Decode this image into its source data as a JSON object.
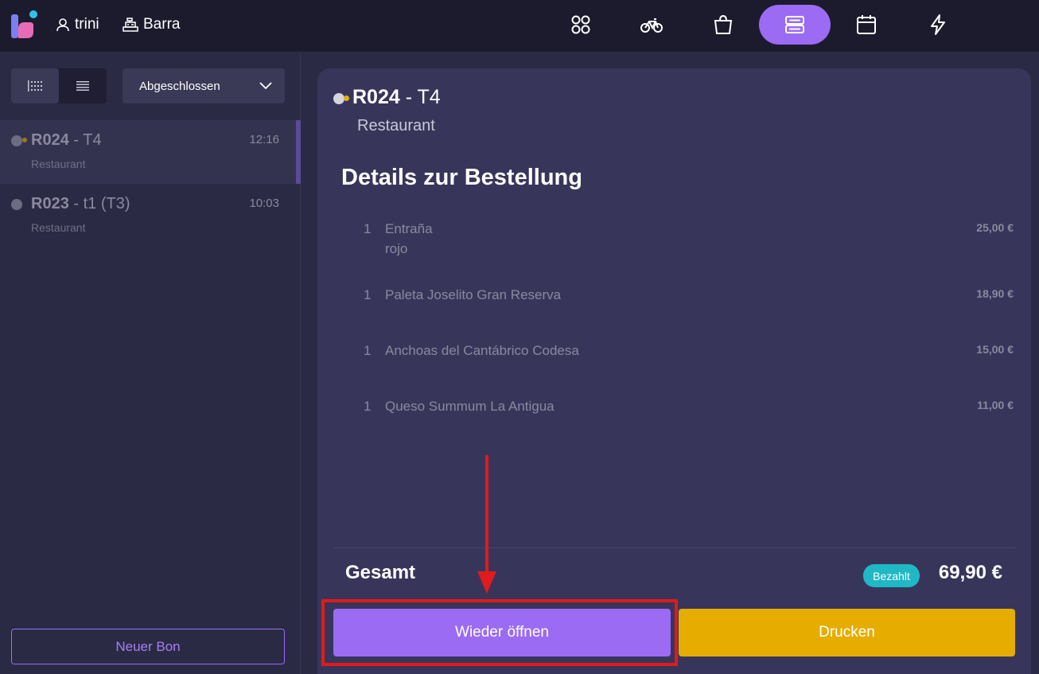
{
  "header": {
    "user_name": "trini",
    "station_name": "Barra",
    "nav_items": [
      {
        "icon": "apps-grid-icon",
        "active": false
      },
      {
        "icon": "bicycle-icon",
        "active": false
      },
      {
        "icon": "shopping-bag-icon",
        "active": false
      },
      {
        "icon": "server-icon",
        "active": true
      },
      {
        "icon": "calendar-icon",
        "active": false
      },
      {
        "icon": "lightning-icon",
        "active": false
      }
    ]
  },
  "sidebar": {
    "filter_selected": "Abgeschlossen",
    "orders": [
      {
        "code": "R024",
        "table": " - T4",
        "type": "Restaurant",
        "time": "12:16",
        "selected": true
      },
      {
        "code": "R023",
        "table": " - t1 (T3)",
        "type": "Restaurant",
        "time": "10:03",
        "selected": false
      }
    ],
    "new_order_label": "Neuer Bon"
  },
  "order": {
    "code": "R024",
    "table": " - T4",
    "type": "Restaurant",
    "details_heading": "Details zur Bestellung",
    "items": [
      {
        "qty": "1",
        "name": "Entraña",
        "modifier": "rojo",
        "price": "25,00 €"
      },
      {
        "qty": "1",
        "name": "Paleta Joselito Gran Reserva",
        "modifier": "",
        "price": "18,90 €"
      },
      {
        "qty": "1",
        "name": "Anchoas del Cantábrico Codesa",
        "modifier": "",
        "price": "15,00 €"
      },
      {
        "qty": "1",
        "name": "Queso Summum La Antigua",
        "modifier": "",
        "price": "11,00 €"
      }
    ],
    "total_label": "Gesamt",
    "status_badge": "Bezahlt",
    "total_amount": "69,90 €",
    "reopen_label": "Wieder öffnen",
    "print_label": "Drucken"
  },
  "colors": {
    "accent": "#9b6bf4",
    "print": "#e6ad00",
    "paid": "#1fb8c4",
    "annotation": "#e01b1b"
  }
}
